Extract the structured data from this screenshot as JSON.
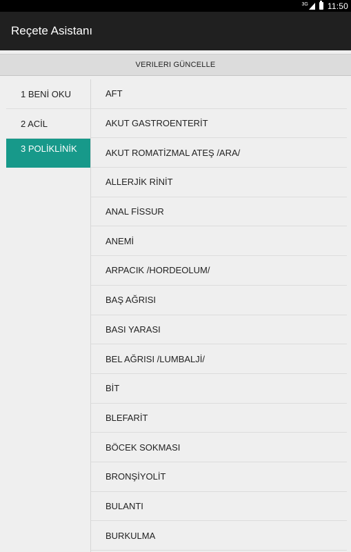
{
  "status_bar": {
    "network": "3G",
    "time": "11:50"
  },
  "app_bar": {
    "title": "Reçete Asistanı"
  },
  "update_button": {
    "label": "VERILERI GÜNCELLE"
  },
  "sidebar": {
    "items": [
      {
        "label": "1 BENİ OKU"
      },
      {
        "label": "2 ACİL"
      },
      {
        "label": "3 POLİKLİNİK"
      }
    ],
    "active_color": "#17998a"
  },
  "list": {
    "items": [
      "AFT",
      "AKUT GASTROENTERİT",
      "AKUT ROMATİZMAL ATEŞ /ARA/",
      "ALLERJİK RİNİT",
      "ANAL FİSSUR",
      "ANEMİ",
      "ARPACIK /HORDEOLUM/",
      "BAŞ AĞRISI",
      "BASI YARASI",
      "BEL AĞRISI /LUMBALJİ/",
      "BİT",
      "BLEFARİT",
      "BÖCEK SOKMASI",
      "BRONŞİYOLİT",
      "BULANTI",
      "BURKULMA"
    ]
  }
}
